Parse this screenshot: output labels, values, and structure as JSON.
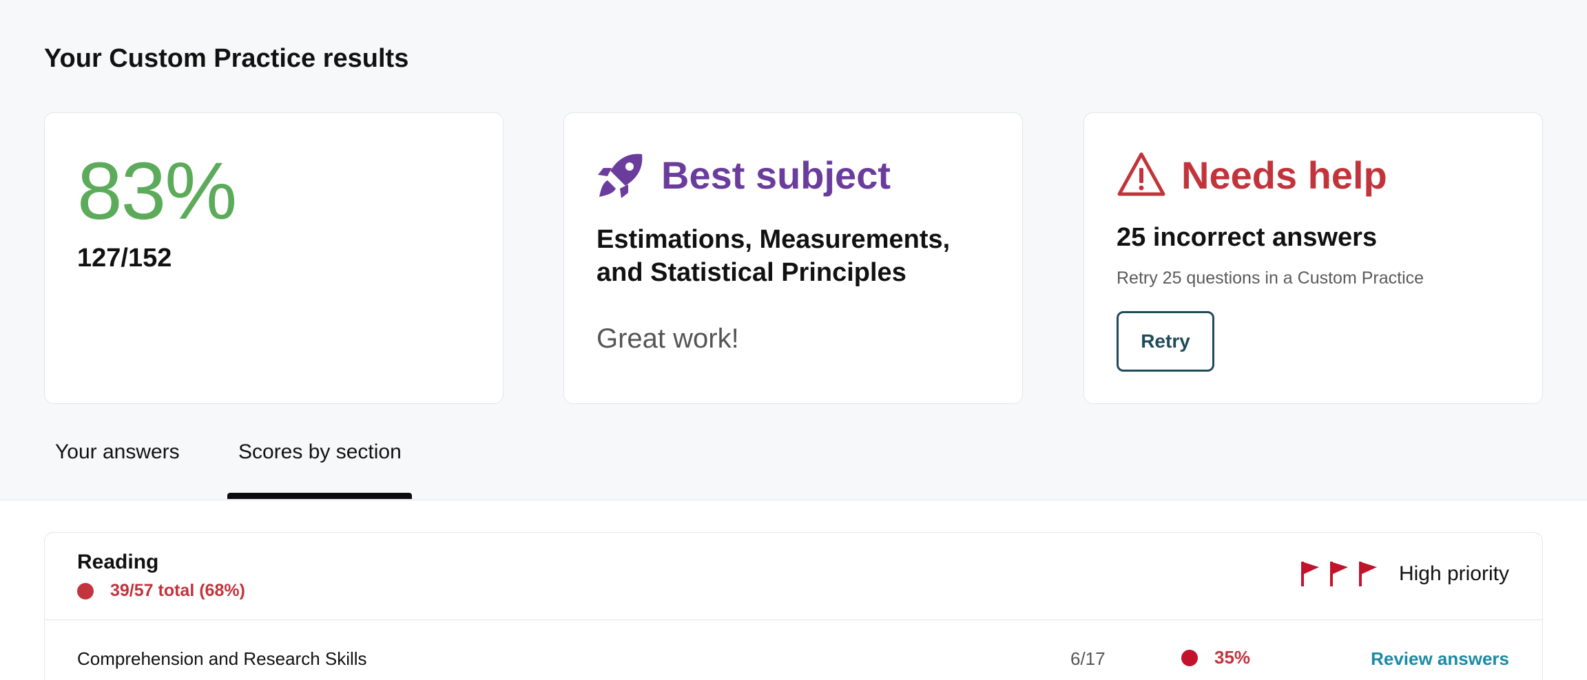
{
  "page": {
    "title": "Your Custom Practice results"
  },
  "score_card": {
    "percent": "83%",
    "fraction": "127/152"
  },
  "best_card": {
    "icon": "rocket-icon",
    "title": "Best subject",
    "subject": "Estimations, Measurements, and Statistical Principles",
    "note": "Great work!"
  },
  "help_card": {
    "icon": "warning-triangle-icon",
    "title": "Needs help",
    "count": "25 incorrect answers",
    "subtitle": "Retry 25 questions in a Custom Practice",
    "retry_label": "Retry"
  },
  "tabs": [
    {
      "label": "Your answers",
      "active": false
    },
    {
      "label": "Scores by section",
      "active": true
    }
  ],
  "section": {
    "name": "Reading",
    "total": "39/57 total (68%)",
    "priority_label": "High priority",
    "rows": [
      {
        "skill": "Comprehension and Research Skills",
        "fraction": "6/17",
        "score": "35%",
        "action": "Review answers"
      }
    ]
  },
  "colors": {
    "score_green": "#5cab5a",
    "best_purple": "#6a3c9c",
    "help_red": "#c2343c",
    "retry_teal": "#1f4a5a",
    "link_blue": "#1b8aa6",
    "flag_red": "#c2122c"
  }
}
